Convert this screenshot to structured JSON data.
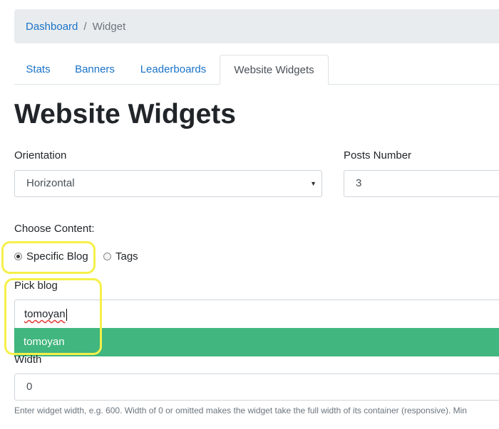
{
  "breadcrumb": {
    "home": "Dashboard",
    "separator": "/",
    "current": "Widget"
  },
  "tabs": [
    {
      "label": "Stats",
      "active": false
    },
    {
      "label": "Banners",
      "active": false
    },
    {
      "label": "Leaderboards",
      "active": false
    },
    {
      "label": "Website Widgets",
      "active": true
    }
  ],
  "page_title": "Website Widgets",
  "orientation": {
    "label": "Orientation",
    "value": "Horizontal",
    "caret": "▼"
  },
  "posts_number": {
    "label": "Posts Number",
    "value": "3"
  },
  "choose_content": {
    "label": "Choose Content:",
    "options": [
      {
        "label": "Specific Blog",
        "checked": true
      },
      {
        "label": "Tags",
        "checked": false
      }
    ]
  },
  "pick_blog": {
    "label": "Pick blog",
    "value": "tomoyan",
    "suggestion": "tomoyan"
  },
  "width": {
    "label": "Width",
    "value": "0",
    "help": "Enter widget width, e.g. 600. Width of 0 or omitted makes the widget take the full width of its container (responsive). Min"
  },
  "colors": {
    "accent_link": "#1a73c8",
    "suggestion_bg": "#41b67e",
    "highlight": "#f5f04a"
  }
}
